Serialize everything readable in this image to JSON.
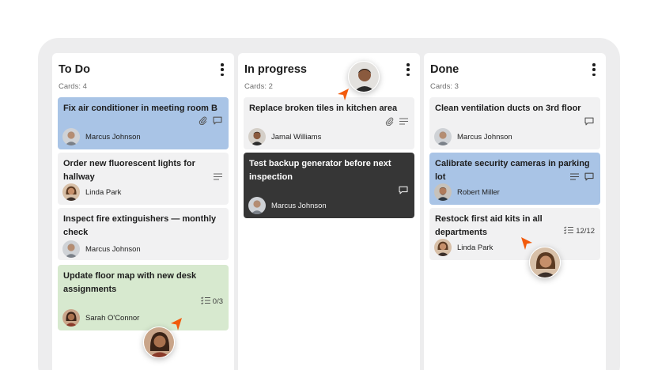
{
  "board": {
    "columns": [
      {
        "title": "To Do",
        "count": "Cards: 4",
        "cards": [
          {
            "title": "Fix air conditioner in meeting room B",
            "assignee": "Marcus Johnson"
          },
          {
            "title": "Order new fluorescent lights for hallway",
            "assignee": "Linda Park"
          },
          {
            "title": "Inspect fire extinguishers — monthly check",
            "assignee": "Marcus Johnson"
          },
          {
            "title": "Update floor map with new desk assignments",
            "assignee": "Sarah O'Connor",
            "checklist": "0/3"
          }
        ]
      },
      {
        "title": "In progress",
        "count": "Cards: 2",
        "cards": [
          {
            "title": "Replace broken tiles in kitchen area",
            "assignee": "Jamal Williams"
          },
          {
            "title": "Test backup generator before next inspection",
            "assignee": "Marcus Johnson"
          }
        ]
      },
      {
        "title": "Done",
        "count": "Cards: 3",
        "cards": [
          {
            "title": "Clean ventilation ducts on 3rd floor",
            "assignee": "Marcus Johnson"
          },
          {
            "title": "Calibrate security cameras in parking lot",
            "assignee": "Robert Miller"
          },
          {
            "title": "Restock first aid kits in all departments",
            "assignee": "Linda Park",
            "checklist": "12/12"
          }
        ]
      }
    ]
  },
  "colors": {
    "card_blue": "#a9c4e6",
    "card_green": "#d7e9cf",
    "card_dark": "#363636",
    "card_default": "#f1f1f2",
    "cursor": "#f25a0c"
  },
  "icons": [
    "kebab-menu-icon",
    "attachment-icon",
    "comment-icon",
    "description-icon",
    "checklist-icon",
    "cursor-pointer-icon"
  ]
}
